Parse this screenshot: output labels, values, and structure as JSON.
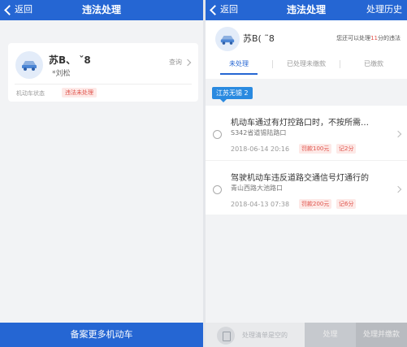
{
  "left": {
    "nav": {
      "back_label": "返回",
      "title": "违法处理"
    },
    "vehicle": {
      "plate": "苏B、  ˇ8",
      "owner": "*刘松",
      "query_label": "查询",
      "status_label": "机动车状态",
      "status_value": "违法未处理"
    },
    "bottom_button": "备案更多机动车"
  },
  "right": {
    "nav": {
      "back_label": "返回",
      "title": "违法处理",
      "history_label": "处理历史"
    },
    "summary": {
      "plate": "苏B(   ˜8",
      "quota_prefix": "您还可以处理",
      "quota_number": "11",
      "quota_suffix": "分的违法"
    },
    "tabs": [
      "未处理",
      "已处理未缴款",
      "已缴款"
    ],
    "region": "江苏无锡 2",
    "violations": [
      {
        "description": "机动车通过有灯控路口时，不按所需…",
        "location": "S342省道锡陆路口",
        "time": "2018-06-14 20:16",
        "fine": "罚款100元",
        "points": "记2分"
      },
      {
        "description": "驾驶机动车违反道路交通信号灯通行的",
        "location": "青山西路大池路口",
        "time": "2018-04-13 07:38",
        "fine": "罚款200元",
        "points": "记6分"
      }
    ],
    "bottom": {
      "cart_text": "处理清单是空的",
      "process_label": "处理",
      "pay_label": "处理并缴款"
    }
  },
  "colors": {
    "primary": "#2566d3",
    "alert": "#e0534b",
    "region_chip": "#2a8ae0"
  }
}
